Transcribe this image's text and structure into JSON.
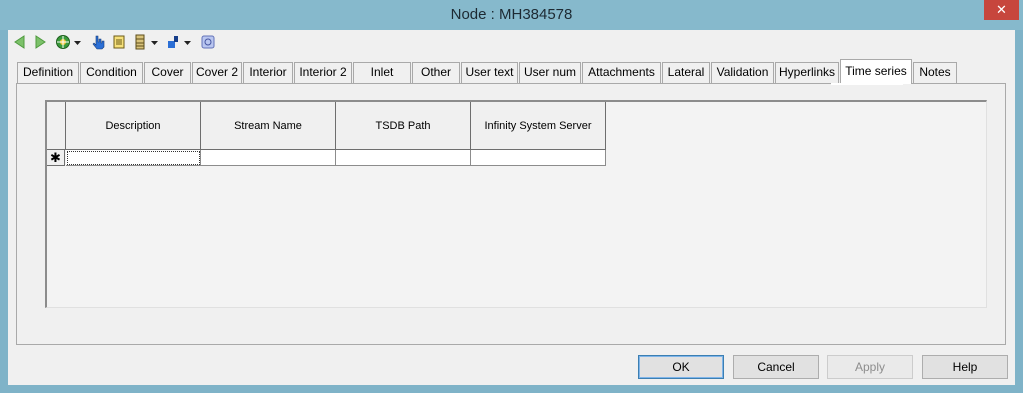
{
  "window": {
    "title": "Node : MH384578",
    "close_label": "✕"
  },
  "toolbar": {
    "icons": [
      "back-arrow-icon",
      "forward-arrow-icon",
      "compass-icon",
      "hand-pointer-icon",
      "notepad-icon",
      "database-icon",
      "paint-bucket-icon",
      "settings-icon"
    ]
  },
  "tabs": [
    {
      "label": "Definition"
    },
    {
      "label": "Condition"
    },
    {
      "label": "Cover"
    },
    {
      "label": "Cover 2"
    },
    {
      "label": "Interior"
    },
    {
      "label": "Interior 2"
    },
    {
      "label": "Inlet"
    },
    {
      "label": "Other"
    },
    {
      "label": "User text"
    },
    {
      "label": "User num"
    },
    {
      "label": "Attachments"
    },
    {
      "label": "Lateral"
    },
    {
      "label": "Validation"
    },
    {
      "label": "Hyperlinks"
    },
    {
      "label": "Time series"
    },
    {
      "label": "Notes"
    }
  ],
  "active_tab": "Time series",
  "grid": {
    "columns": [
      {
        "label": "Description"
      },
      {
        "label": "Stream Name"
      },
      {
        "label": "TSDB Path"
      },
      {
        "label": "Infinity System Server"
      }
    ],
    "new_row_marker": "✱"
  },
  "buttons": {
    "ok": "OK",
    "cancel": "Cancel",
    "apply": "Apply",
    "help": "Help"
  }
}
